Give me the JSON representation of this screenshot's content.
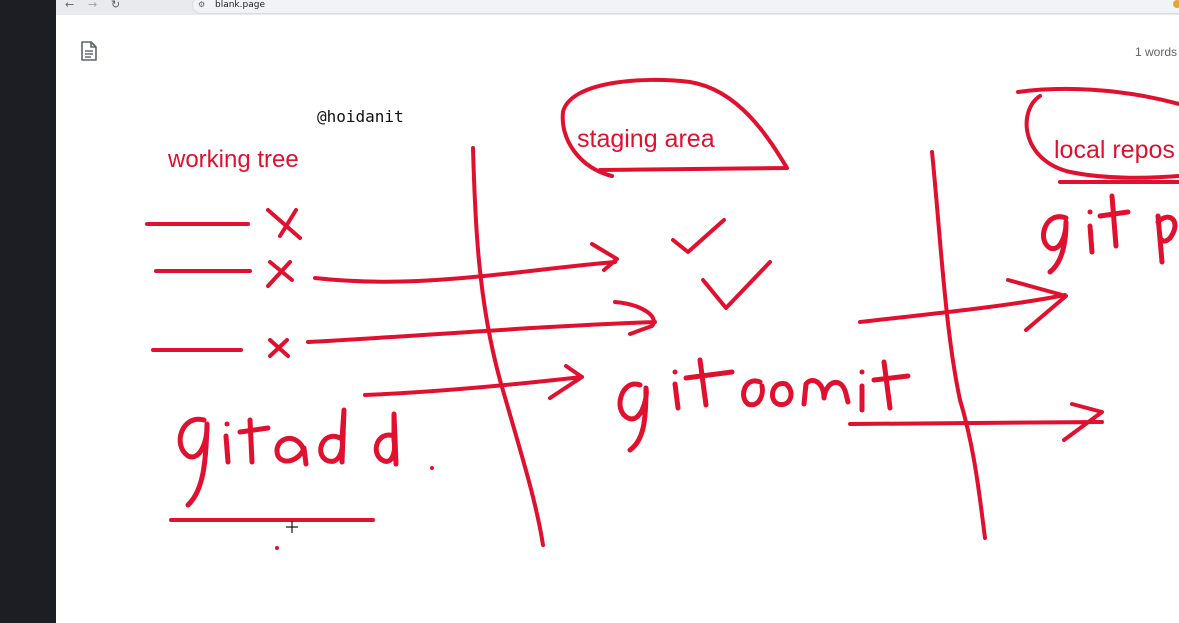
{
  "browser": {
    "back_icon": "arrow-left-icon",
    "forward_icon": "arrow-right-icon",
    "reload_icon": "reload-icon",
    "url": "blank.page",
    "bookmark_icon": "star-icon"
  },
  "editor": {
    "document_icon": "document-icon",
    "word_count": "1 words"
  },
  "canvas": {
    "handle": "@hoidanit",
    "labels": {
      "working_tree": "working tree",
      "staging_area": "staging area",
      "local_repo": "local repos"
    },
    "handwriting": {
      "git_add": "gitadd",
      "git_commit": "gitcomit",
      "git_push_partial": "git p"
    },
    "ink_color": "#e0102e"
  }
}
